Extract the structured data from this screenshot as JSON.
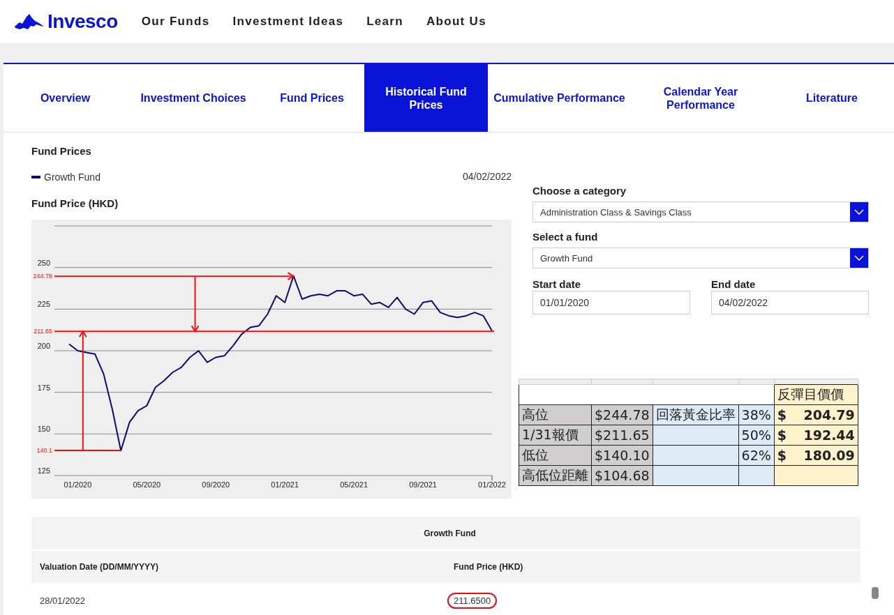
{
  "header": {
    "logo": "Invesco",
    "nav": [
      "Our Funds",
      "Investment Ideas",
      "Learn",
      "About Us"
    ]
  },
  "tabs": [
    {
      "label": "Overview",
      "selected": false
    },
    {
      "label": "Investment Choices",
      "selected": false
    },
    {
      "label": "Fund Prices",
      "selected": false
    },
    {
      "label": "Historical Fund Prices",
      "selected": true
    },
    {
      "label": "Cumulative Performance",
      "selected": false
    },
    {
      "label": "Calendar Year Performance",
      "selected": false
    },
    {
      "label": "Literature",
      "selected": false
    }
  ],
  "fund_prices": {
    "title": "Fund Prices",
    "legend": {
      "date": "04/02/2022"
    },
    "chart_title": "Fund Price (HKD)",
    "chart_data": {
      "type": "line",
      "grid": true,
      "ylim": [
        125,
        275
      ],
      "yticks": [
        125,
        150,
        175,
        200,
        225,
        250
      ],
      "categories": [
        null,
        "01/2020",
        null,
        null,
        null,
        null,
        null,
        null,
        null,
        "05/2020",
        null,
        null,
        null,
        null,
        null,
        null,
        null,
        "09/2020",
        null,
        null,
        null,
        null,
        null,
        null,
        null,
        "01/2021",
        null,
        null,
        null,
        null,
        null,
        null,
        null,
        "05/2021",
        null,
        null,
        null,
        null,
        null,
        null,
        null,
        "09/2021",
        null,
        null,
        null,
        null,
        null,
        null,
        null,
        "01/2022"
      ],
      "series": [
        {
          "name": "Growth Fund",
          "color": "#0a0a78",
          "values": [
            204,
            200,
            199,
            198,
            186,
            165,
            140,
            157,
            164,
            167,
            178,
            182,
            187,
            190,
            196,
            200,
            193,
            196,
            197,
            203,
            210,
            214,
            215,
            222,
            233,
            229,
            245,
            231,
            233,
            234,
            233,
            236,
            236,
            233,
            234,
            228,
            229,
            226,
            232,
            225,
            222,
            229,
            230,
            223,
            221,
            220,
            221,
            223,
            221,
            212
          ]
        }
      ],
      "ref_lines": [
        {
          "axis": "y",
          "value": 244.78,
          "label": "244.78"
        },
        {
          "axis": "y",
          "value": 211.65,
          "label": "211.65"
        },
        {
          "axis": "y",
          "value": 140.1,
          "label": "140.1"
        }
      ]
    }
  },
  "selectors": {
    "category": {
      "label": "Choose a category",
      "value": "Administration Class & Savings Class"
    },
    "fund": {
      "label": "Select a fund",
      "value": "Growth Fund"
    },
    "start": {
      "label": "Start date",
      "value": "01/01/2020"
    },
    "end": {
      "label": "End date",
      "value": "04/02/2022"
    }
  },
  "spreadsheet": {
    "header": "反彈目價價",
    "rows": [
      {
        "label": "高位",
        "price": "$244.78",
        "note": "回落黃金比率",
        "percent": "38%",
        "currency": "$",
        "target": "204.79"
      },
      {
        "label": "1/31報價",
        "price": "$211.65",
        "percent": "50%",
        "currency": "$",
        "target": "192.44"
      },
      {
        "label": "低位",
        "price": "$140.10",
        "percent": "62%",
        "currency": "$",
        "target": "180.09"
      },
      {
        "label": "高低位距離",
        "price": "$104.68"
      }
    ]
  },
  "table": {
    "caption": "Growth Fund",
    "columns": [
      "Valuation Date (DD/MM/YYYY)",
      "Fund Price (HKD)"
    ],
    "rows": [
      {
        "date": "28/01/2022",
        "price": "211.6500",
        "circled": true
      }
    ]
  }
}
